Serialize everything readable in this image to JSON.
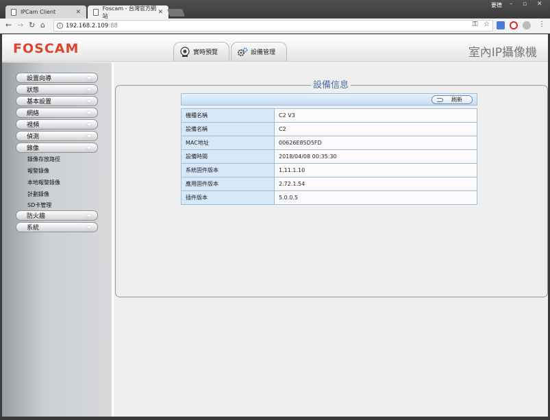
{
  "browser": {
    "tabs": [
      {
        "label": "IPCam Client",
        "active": false
      },
      {
        "label": "Foscam - 台灣官方網站",
        "active": true
      }
    ],
    "window_user": "要德",
    "address": {
      "host": "192.168.2.109",
      "port": ":88"
    }
  },
  "header": {
    "logo": "FOSCAM",
    "tabs": [
      {
        "label": "實時預覽"
      },
      {
        "label": "設備管理"
      }
    ],
    "product_title": "室內IP攝像機"
  },
  "sidebar": {
    "menu": [
      {
        "label": "設置向導"
      },
      {
        "label": "狀態"
      },
      {
        "label": "基本設置"
      },
      {
        "label": "網絡"
      },
      {
        "label": "視頻"
      },
      {
        "label": "偵測"
      },
      {
        "label": "錄像"
      }
    ],
    "submenu": [
      {
        "label": "錄像存放路徑"
      },
      {
        "label": "報警錄像"
      },
      {
        "label": "本地報警錄像"
      },
      {
        "label": "計劃錄像"
      },
      {
        "label": "SD卡管理"
      }
    ],
    "menu_after": [
      {
        "label": "防火牆"
      },
      {
        "label": "系統"
      }
    ]
  },
  "content": {
    "title": "設備信息",
    "refresh_label": "刷新",
    "rows": [
      {
        "key": "機種名稱",
        "value": "C2 V3"
      },
      {
        "key": "設備名稱",
        "value": "C2"
      },
      {
        "key": "MAC地址",
        "value": "00626E85D5FD"
      },
      {
        "key": "設備時間",
        "value": "2018/04/08 00:35:30"
      },
      {
        "key": "系統固件版本",
        "value": "1.11.1.10"
      },
      {
        "key": "應用固件版本",
        "value": "2.72.1.54"
      },
      {
        "key": "插件版本",
        "value": "5.0.0.5"
      }
    ]
  },
  "colors": {
    "logo": "#e0432c",
    "accent": "#4a6ea8",
    "table_key_bg": "#d7e8f8"
  }
}
